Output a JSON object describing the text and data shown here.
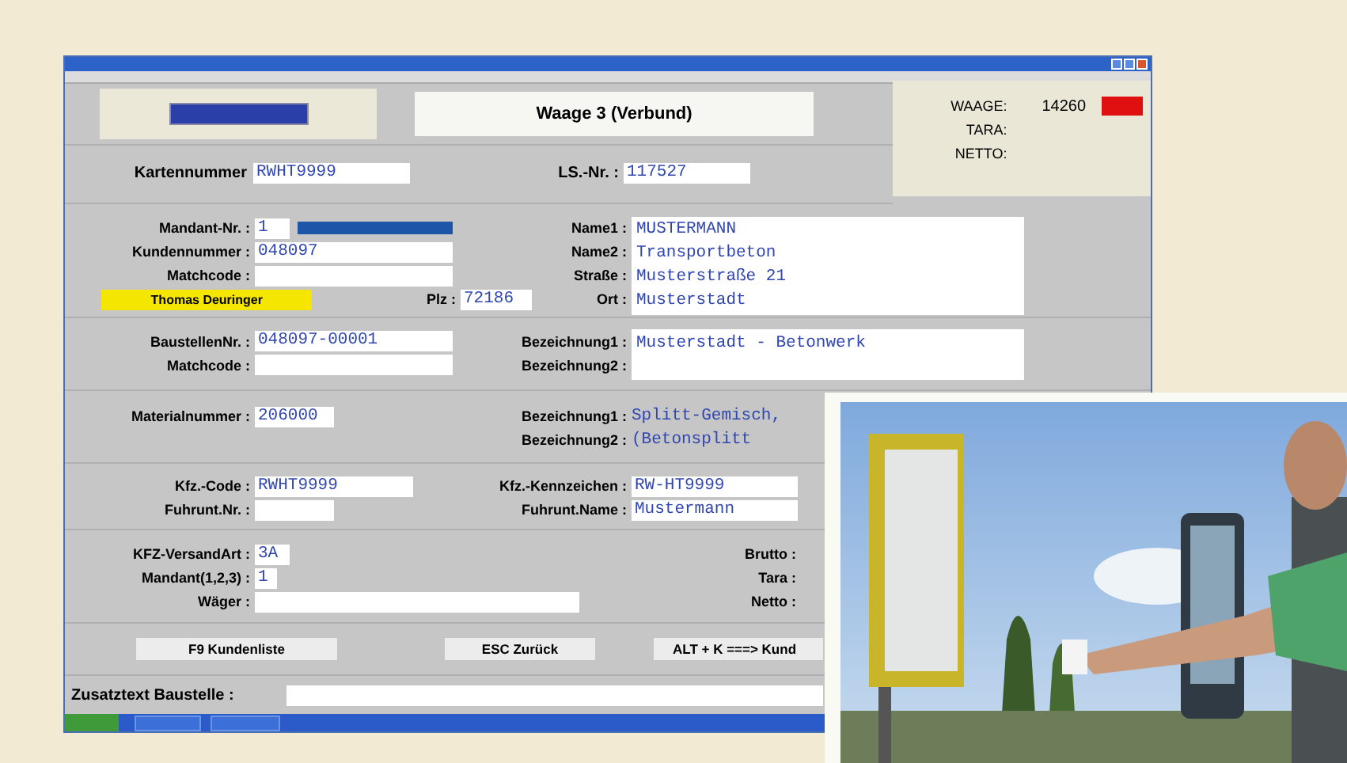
{
  "header": {
    "title": "Waage 3 (Verbund)"
  },
  "scale": [
    {
      "label": "WAAGE:",
      "value": "14260"
    },
    {
      "label": "TARA:"
    },
    {
      "label": "NETTO:"
    }
  ],
  "card": {
    "label": "Kartennummer",
    "value": "RWHT9999"
  },
  "delivery_note": {
    "label": "LS.-Nr. :",
    "value": "117527"
  },
  "customer": {
    "fields": [
      {
        "label": "Mandant-Nr. :",
        "value": "1"
      },
      {
        "label": "Kundennummer :",
        "value": "048097"
      },
      {
        "label": "Matchcode :"
      }
    ],
    "contact": "Thomas Deuringer",
    "plz": {
      "label": "Plz :",
      "value": "72186"
    },
    "address": [
      {
        "label": "Name1 :",
        "value": "MUSTERMANN"
      },
      {
        "label": "Name2 :",
        "value": "Transportbeton"
      },
      {
        "label": "Straße :",
        "value": "Musterstraße 21"
      },
      {
        "label": "Ort :",
        "value": "Musterstadt"
      }
    ]
  },
  "site": {
    "fields": [
      {
        "label": "BaustellenNr. :",
        "value": "048097-00001"
      },
      {
        "label": "Matchcode :"
      }
    ],
    "description": [
      {
        "label": "Bezeichnung1 :",
        "value": "Musterstadt - Betonwerk"
      },
      {
        "label": "Bezeichnung2 :"
      }
    ]
  },
  "material": {
    "fields": [
      {
        "label": "Materialnummer :",
        "value": "206000"
      }
    ],
    "description": [
      {
        "label": "Bezeichnung1 :",
        "value": "Splitt-Gemisch,"
      },
      {
        "label": "Bezeichnung2 :",
        "value": "(Betonsplitt"
      }
    ]
  },
  "vehicle": {
    "fields": [
      {
        "label": "Kfz.-Code :",
        "value": "RWHT9999"
      },
      {
        "label": "Fuhrunt.Nr. :"
      }
    ],
    "details": [
      {
        "label": "Kfz.-Kennzeichen :",
        "value": "RW-HT9999"
      },
      {
        "label": "Fuhrunt.Name :",
        "value": "Mustermann"
      }
    ]
  },
  "dispatch": {
    "fields": [
      {
        "label": "KFZ-VersandArt :",
        "value": "3A"
      },
      {
        "label": "Mandant(1,2,3) :",
        "value": "1"
      },
      {
        "label": "Wäger :"
      }
    ],
    "weights": [
      "Brutto :",
      "Tara :",
      "Netto :"
    ]
  },
  "buttons": [
    "F9 Kundenliste",
    "ESC Zurück",
    "ALT + K ===> Kund"
  ],
  "note": {
    "label": "Zusatztext Baustelle :"
  }
}
